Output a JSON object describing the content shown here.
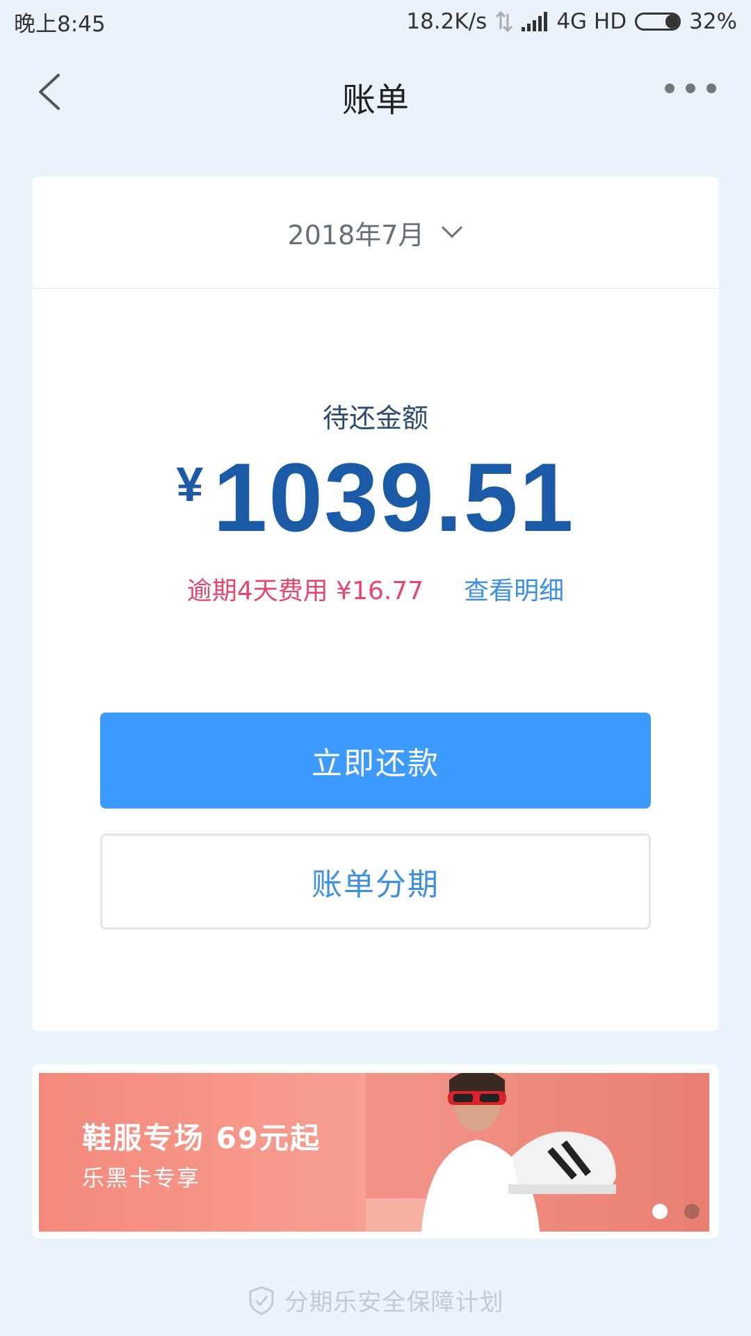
{
  "status_bar": {
    "time": "晚上8:45",
    "network_speed": "18.2K/s",
    "network_type": "4G HD",
    "battery": "32%",
    "battery_level": 0.32
  },
  "nav": {
    "title": "账单"
  },
  "bill": {
    "month": "2018年7月",
    "amount_label": "待还金额",
    "currency": "¥",
    "amount": "1039.51",
    "overdue_text": "逾期4天费用 ¥16.77",
    "detail_link": "查看明细",
    "pay_button": "立即还款",
    "installment_button": "账单分期"
  },
  "banner": {
    "title": "鞋服专场 69元起",
    "subtitle": "乐黑卡专享",
    "active_slide": 1,
    "slide_count": 2
  },
  "footer": {
    "text": "分期乐安全保障计划"
  },
  "colors": {
    "page_bg": "#eaf2fb",
    "primary": "#3d9bff",
    "amount": "#1b5aa6",
    "overdue": "#e8456d",
    "link": "#3d8fe0"
  }
}
